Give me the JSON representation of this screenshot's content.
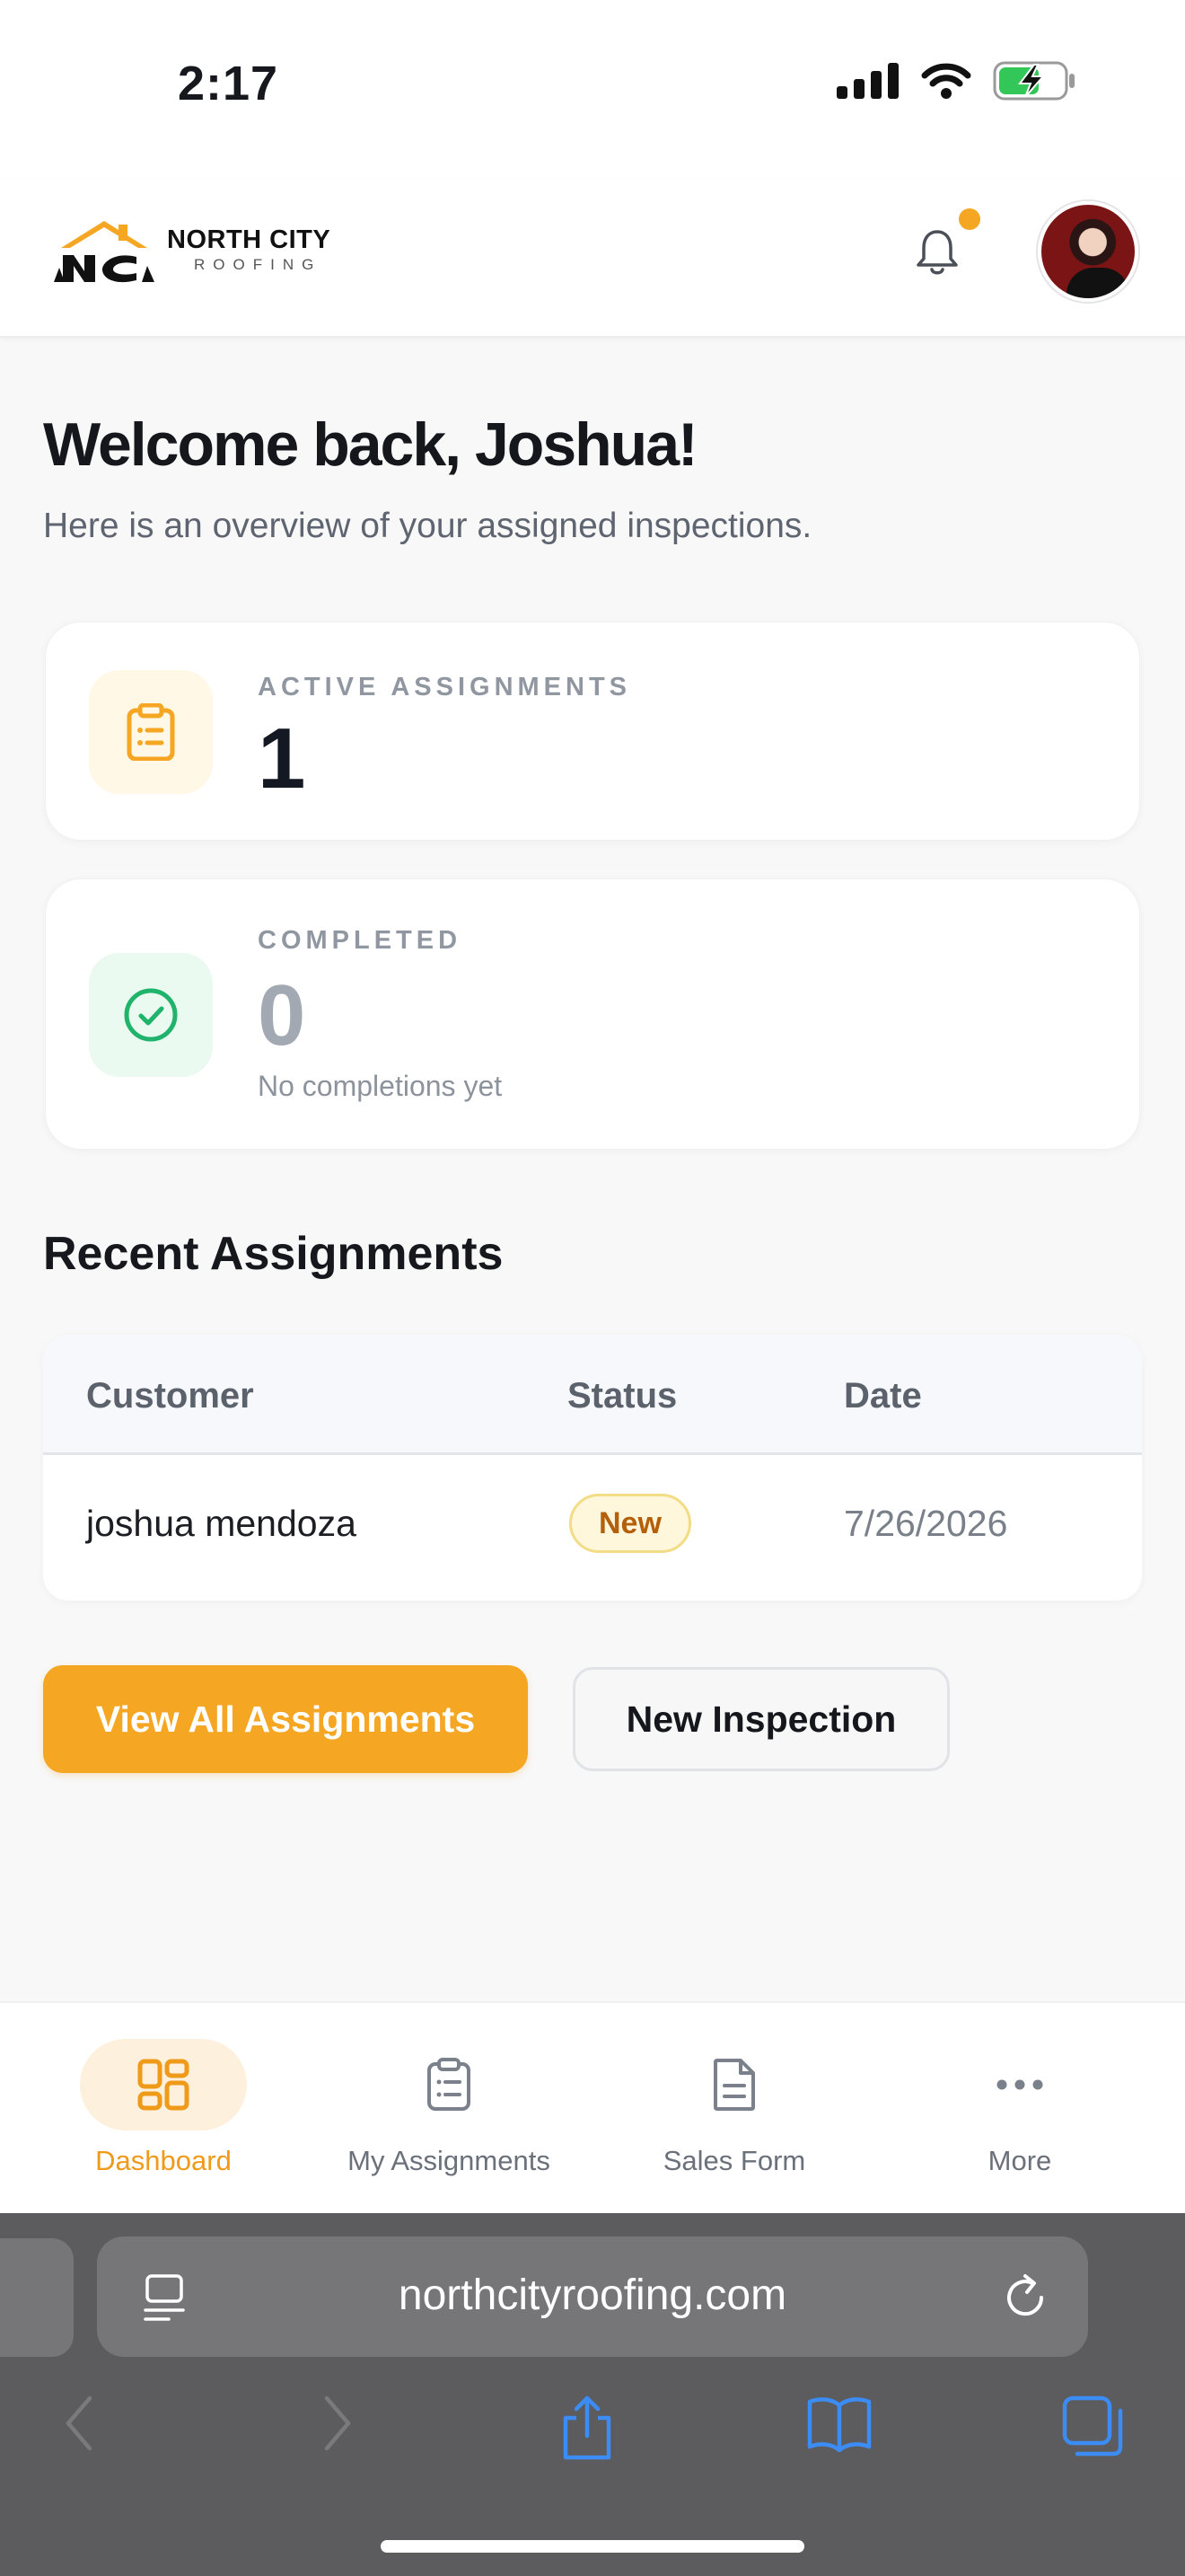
{
  "status_bar": {
    "time": "2:17"
  },
  "header": {
    "logo_name": "NORTH CITY",
    "logo_sub": "ROOFING",
    "has_unread_notifications": true
  },
  "welcome": {
    "title": "Welcome back, Joshua!",
    "subtitle": "Here is an overview of your assigned inspections."
  },
  "stats": {
    "active": {
      "label": "ACTIVE ASSIGNMENTS",
      "value": "1"
    },
    "completed": {
      "label": "COMPLETED",
      "value": "0",
      "note": "No completions yet"
    }
  },
  "recent": {
    "title": "Recent Assignments",
    "columns": [
      "Customer",
      "Status",
      "Date"
    ],
    "rows": [
      {
        "customer": "joshua mendoza",
        "status": "New",
        "date": "7/26/2026"
      }
    ]
  },
  "actions": {
    "view_all": "View All Assignments",
    "new_inspection": "New Inspection"
  },
  "tabbar": {
    "items": [
      {
        "label": "Dashboard",
        "icon": "dashboard-grid-icon",
        "active": true
      },
      {
        "label": "My Assignments",
        "icon": "clipboard-icon",
        "active": false
      },
      {
        "label": "Sales Form",
        "icon": "document-icon",
        "active": false
      },
      {
        "label": "More",
        "icon": "more-dots-icon",
        "active": false
      }
    ]
  },
  "browser": {
    "url": "northcityroofing.com"
  },
  "colors": {
    "accent": "#f5a623",
    "success": "#1fb36b",
    "badge_bg": "#fff7dc",
    "badge_text": "#b45f0a"
  }
}
